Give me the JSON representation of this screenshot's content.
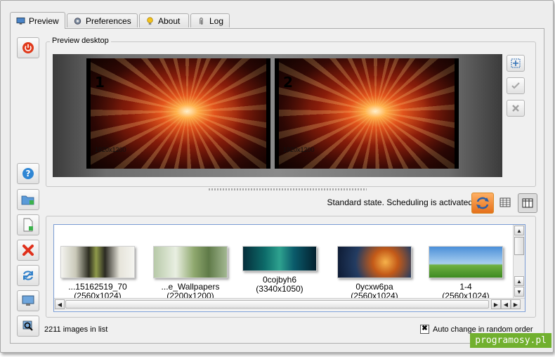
{
  "tabs": [
    {
      "label": "Preview",
      "icon": "monitor-icon",
      "active": true
    },
    {
      "label": "Preferences",
      "icon": "gear-icon",
      "active": false
    },
    {
      "label": "About",
      "icon": "lightbulb-icon",
      "active": false
    },
    {
      "label": "Log",
      "icon": "paperclip-icon",
      "active": false
    }
  ],
  "sidebar": [
    {
      "name": "power-button",
      "icon": "power-icon"
    },
    {
      "name": "help-button",
      "icon": "question-icon"
    },
    {
      "name": "add-folder-button",
      "icon": "folder-add-icon"
    },
    {
      "name": "add-file-button",
      "icon": "file-add-icon"
    },
    {
      "name": "remove-button",
      "icon": "red-x-icon"
    },
    {
      "name": "refresh-button",
      "icon": "refresh-icon"
    },
    {
      "name": "set-wallpaper-button",
      "icon": "desktop-icon"
    },
    {
      "name": "search-button",
      "icon": "magnifier-icon"
    }
  ],
  "preview": {
    "group_label": "Preview desktop",
    "monitors": [
      {
        "number": "1",
        "resolution": "1920x1200"
      },
      {
        "number": "2",
        "resolution": "1920x1200"
      }
    ],
    "side_buttons": [
      "fit-icon",
      "check-icon",
      "close-icon"
    ]
  },
  "status": {
    "text": "Standard state. Scheduling is activated",
    "icons": [
      "schedule-icon",
      "grid-view-icon",
      "columns-view-icon"
    ]
  },
  "thumbnails": [
    {
      "name": "...15162519_70",
      "size": "(2560x1024)"
    },
    {
      "name": "...e_Wallpapers",
      "size": "(2200x1200)"
    },
    {
      "name": "0cojbyh6",
      "size": "(3340x1050)"
    },
    {
      "name": "0ycxw6pa",
      "size": "(2560x1024)"
    },
    {
      "name": "1-4",
      "size": "(2560x1024)"
    }
  ],
  "footer": {
    "count": "2211 images in list",
    "checkbox_label": "Auto change in random order",
    "checkbox_checked": true
  },
  "watermark": "programosy.pl",
  "colors": {
    "accent_red": "#e03a1b",
    "help_blue": "#2f86d4",
    "list_border": "#7a9cd3",
    "watermark_green": "#71b02e"
  }
}
